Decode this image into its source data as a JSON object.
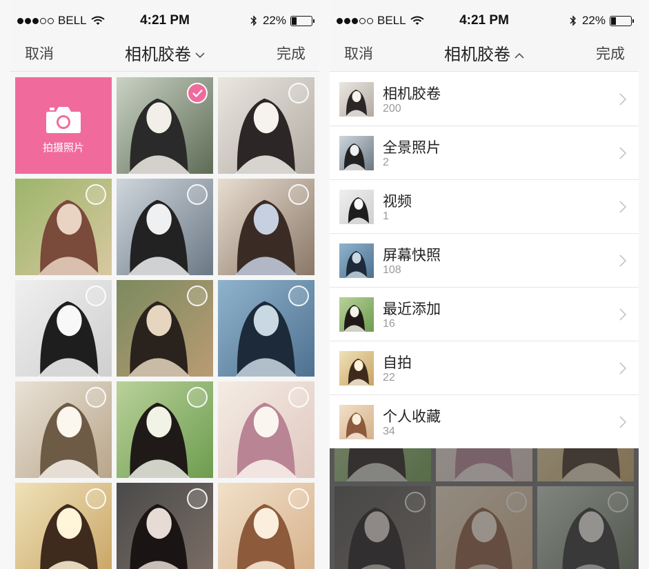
{
  "status": {
    "carrier": "BELL",
    "time": "4:21 PM",
    "battery": "22%",
    "battery_level": 0.22
  },
  "left": {
    "nav": {
      "cancel": "取消",
      "title": "相机胶卷",
      "done": "完成",
      "title_icon": "chevron-down-icon"
    },
    "camera_tile": {
      "label": "拍摄照片",
      "icon": "camera-icon"
    },
    "photos": [
      {
        "selected": true
      },
      {
        "selected": false
      },
      {
        "selected": false
      },
      {
        "selected": false
      },
      {
        "selected": false
      },
      {
        "selected": false
      },
      {
        "selected": false
      },
      {
        "selected": false
      },
      {
        "selected": false
      },
      {
        "selected": false
      },
      {
        "selected": false
      },
      {
        "selected": false
      },
      {
        "selected": false
      },
      {
        "selected": false
      }
    ]
  },
  "right": {
    "nav": {
      "cancel": "取消",
      "title": "相机胶卷",
      "done": "完成",
      "title_icon": "chevron-up-icon"
    },
    "albums": [
      {
        "name": "相机胶卷",
        "count": "200"
      },
      {
        "name": "全景照片",
        "count": "2"
      },
      {
        "name": "视频",
        "count": "1"
      },
      {
        "name": "屏幕快照",
        "count": "108"
      },
      {
        "name": "最近添加",
        "count": "16"
      },
      {
        "name": "自拍",
        "count": "22"
      },
      {
        "name": "个人收藏",
        "count": "34"
      }
    ]
  },
  "colors": {
    "accent": "#f06b9c",
    "nav_bg": "#f6f6f6",
    "text": "#222222",
    "muted": "#999999"
  }
}
